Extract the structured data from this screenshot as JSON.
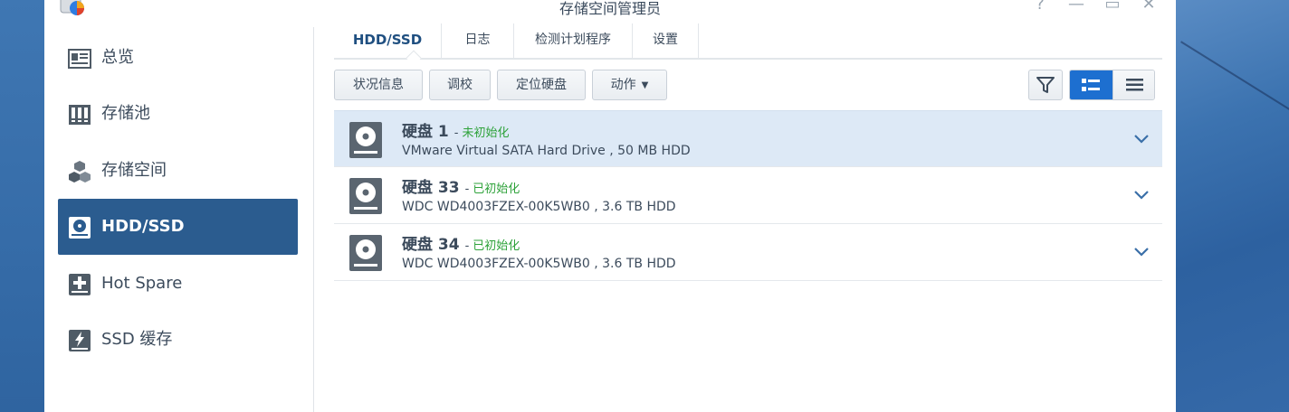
{
  "window": {
    "title": "存储空间管理员",
    "controls": {
      "help": "?",
      "minimize": "—",
      "maximize": "▭",
      "close": "✕"
    }
  },
  "sidebar": {
    "items": [
      {
        "label": "总览",
        "icon": "overview-icon"
      },
      {
        "label": "存储池",
        "icon": "storage-pool-icon"
      },
      {
        "label": "存储空间",
        "icon": "volume-cubes-icon"
      },
      {
        "label": "HDD/SSD",
        "icon": "hdd-icon",
        "active": true
      },
      {
        "label": "Hot Spare",
        "icon": "hot-spare-icon"
      },
      {
        "label": "SSD 缓存",
        "icon": "ssd-cache-icon"
      }
    ]
  },
  "tabs": [
    {
      "label": "HDD/SSD",
      "active": true
    },
    {
      "label": "日志"
    },
    {
      "label": "检测计划程序"
    },
    {
      "label": "设置"
    }
  ],
  "toolbar": {
    "status_info": "状况信息",
    "calibrate": "调校",
    "locate_disk": "定位硬盘",
    "action": "动作",
    "filter_icon": "filter-icon",
    "view_options": [
      "detail-list-icon",
      "compact-list-icon"
    ],
    "active_view": "detail-list"
  },
  "disks": [
    {
      "name": "硬盘 1",
      "status": "未初始化",
      "description": "VMware Virtual SATA Hard Drive , 50 MB HDD",
      "selected": true
    },
    {
      "name": "硬盘 33",
      "status": "已初始化",
      "description": "WDC WD4003FZEX-00K5WB0 , 3.6 TB HDD"
    },
    {
      "name": "硬盘 34",
      "status": "已初始化",
      "description": "WDC WD4003FZEX-00K5WB0 , 3.6 TB HDD"
    }
  ],
  "colors": {
    "accent": "#2b5c8f",
    "view_active": "#1d6fd0",
    "status_ok": "#2ea23a",
    "selected_row": "#dde9f6"
  }
}
